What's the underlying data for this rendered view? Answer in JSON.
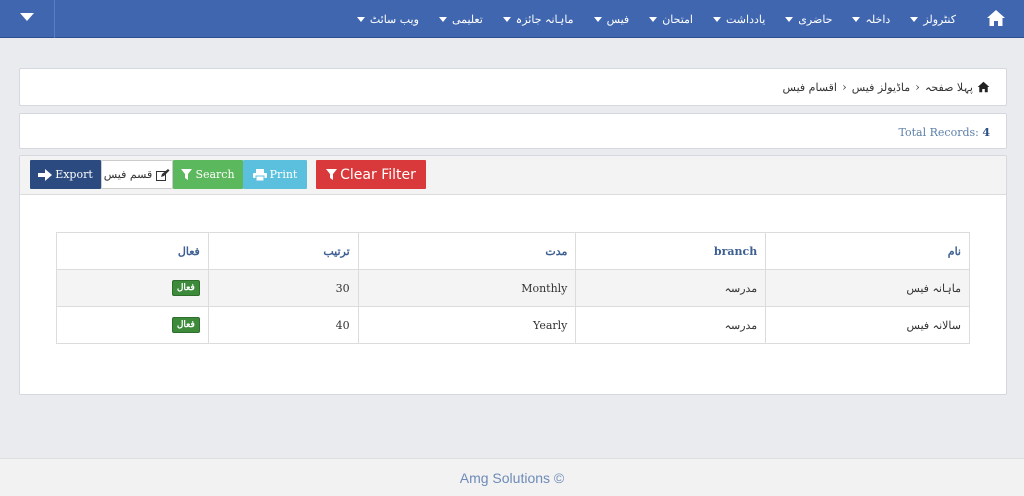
{
  "navbar": {
    "items": [
      {
        "label": "کنٹرولز"
      },
      {
        "label": "داخلہ"
      },
      {
        "label": "حاضری"
      },
      {
        "label": "یادداشت"
      },
      {
        "label": "امتحان"
      },
      {
        "label": "فیس"
      },
      {
        "label": "ماہانہ جائزہ"
      },
      {
        "label": "تعلیمی"
      },
      {
        "label": "ویب سائٹ"
      }
    ]
  },
  "breadcrumb": {
    "items": [
      "پہلا صفحہ",
      "ماڈیولز فیس",
      "اقسام فیس"
    ]
  },
  "records": {
    "label": "Total Records:",
    "count": "4"
  },
  "toolbar": {
    "export_label": "Export",
    "type_label": "قسم فیس",
    "search_label": "Search",
    "print_label": "Print",
    "clear_label": "Clear Filter"
  },
  "table": {
    "headers": [
      "نام",
      "branch",
      "مدت",
      "ترتیب",
      "فعال"
    ],
    "rows": [
      {
        "name": "ماہانہ فیس",
        "branch": "مدرسہ",
        "period": "Monthly",
        "order": "30",
        "active": "فعال"
      },
      {
        "name": "سالانہ فیس",
        "branch": "مدرسہ",
        "period": "Yearly",
        "order": "40",
        "active": "فعال"
      }
    ]
  },
  "footer": {
    "text": "Amg Solutions ©"
  },
  "colors": {
    "navbar": "#3f66ae",
    "export": "#2a4a80",
    "search": "#5cb85c",
    "print": "#5bc0de",
    "clear": "#d9393a",
    "badge": "#3c8a3a"
  }
}
